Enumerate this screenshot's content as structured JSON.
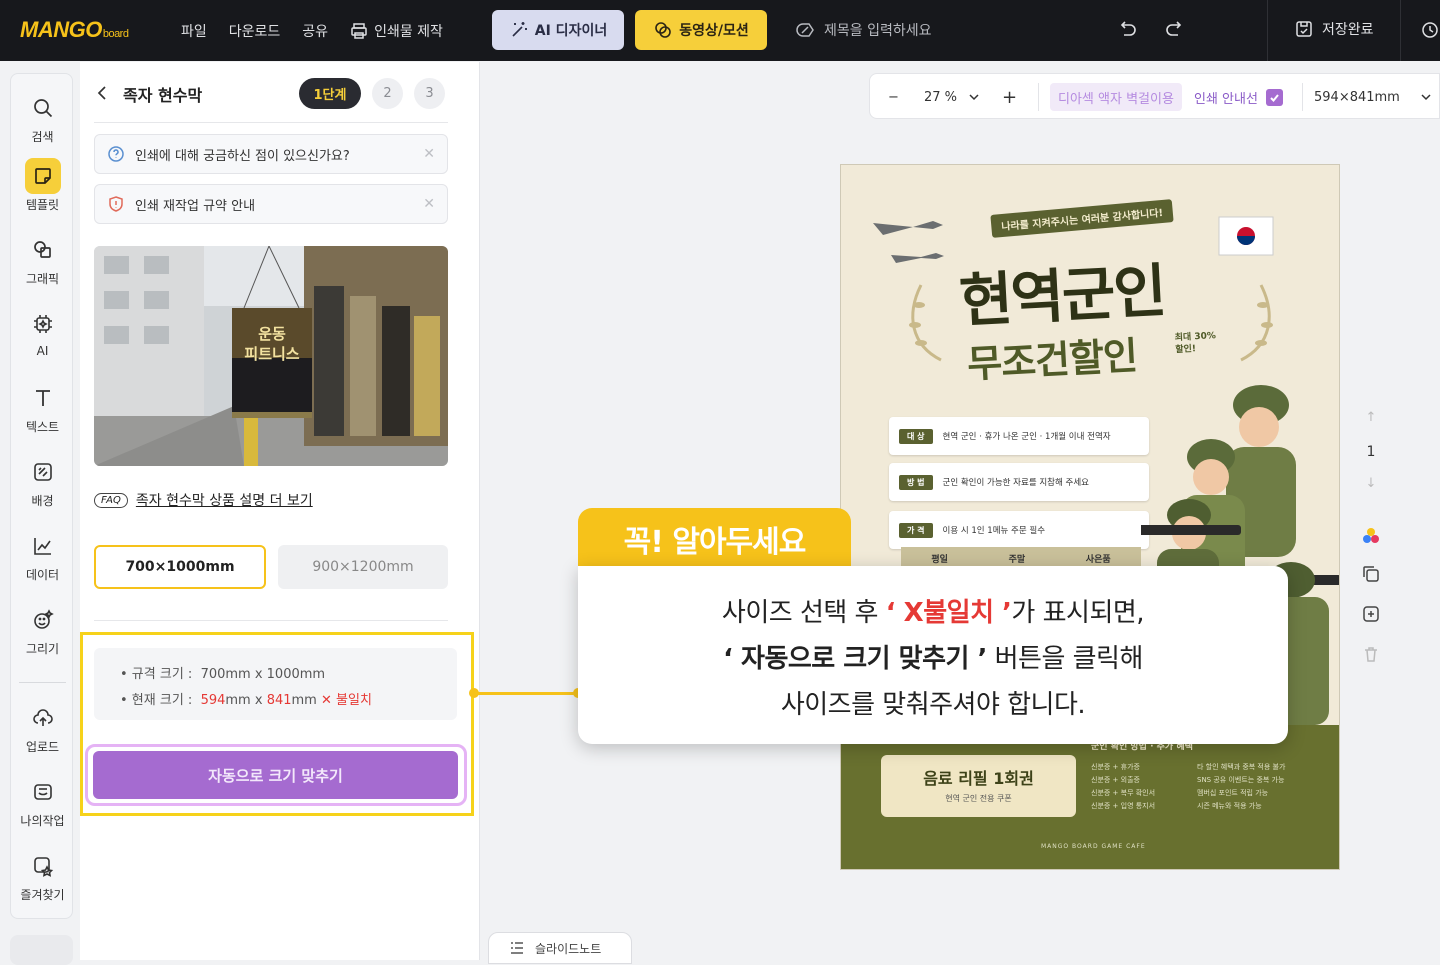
{
  "topbar": {
    "logo_main": "MANGO",
    "logo_sub": "board",
    "menu": [
      "파일",
      "다운로드",
      "공유",
      "인쇄물 제작"
    ],
    "ai_designer": "AI 디자이너",
    "video_motion": "동영상/모션",
    "title_placeholder": "제목을 입력하세요",
    "save_status": "저장완료"
  },
  "leftnav": {
    "items": [
      "검색",
      "템플릿",
      "그래픽",
      "AI",
      "텍스트",
      "배경",
      "데이터",
      "그리기",
      "업로드",
      "나의작업",
      "즐겨찾기"
    ],
    "active": "템플릿"
  },
  "panel": {
    "title": "족자 현수막",
    "steps": [
      "1단계",
      "2",
      "3"
    ],
    "notice1": "인쇄에 대해 궁금하신 점이 있으신가요?",
    "notice2": "인쇄 재작업 규약 안내",
    "faq_tag": "FAQ",
    "faq_link": "족자 현수막 상품 설명 더 보기",
    "size_options": [
      "700×1000mm",
      "900×1200mm"
    ],
    "selected_size": "700×1000mm",
    "spec_label": "• 규격 크기 :",
    "spec_value": "700mm x 1000mm",
    "current_label": "• 현재 크기 :",
    "current_w": "594",
    "current_mm1": "mm x",
    "current_h": "841",
    "current_mm2": "mm",
    "mismatch": "불일치",
    "autofit_button": "자동으로 크기 맞추기"
  },
  "photo": {
    "poster_line1": "운동",
    "poster_line2": "피트니스"
  },
  "canvas_toolbar": {
    "zoom": "27 %",
    "minus": "−",
    "plus": "+",
    "material_tag": "디아섹 액자 벽걸이용",
    "print_guide": "인쇄 안내선",
    "paper_size": "594×841mm"
  },
  "poster": {
    "banner": "나라를 지켜주시는 여러분 감사합니다!",
    "title": "현역군인",
    "subtitle": "무조건할인",
    "max_badge": "최대 30% 할인!",
    "rows": [
      {
        "tag": "대 상",
        "text": "현역 군인 · 휴가 나온 군인 · 1개월 이내 전역자"
      },
      {
        "tag": "방 법",
        "text": "군인 확인이 가능한 자료를 지참해 주세요"
      },
      {
        "tag": "가 격",
        "text": "이용 시 1인 1메뉴 주문 필수"
      }
    ],
    "table_headers": [
      "평일",
      "주말",
      "사은품"
    ],
    "coupon_title": "음료 리필 1회권",
    "coupon_sub": "현역 군인 전용 쿠폰",
    "benefit_head": "군인 확인 방법 · 추가 혜택",
    "list_left": [
      "신분증 + 휴가증",
      "신분증 + 외출증",
      "신분증 + 복무 확인서",
      "신분증 + 입영 통지서"
    ],
    "list_right": [
      "타 할인 혜택과 중복 적용 불가",
      "SNS 공유 이벤트는 중복 가능",
      "멤버십 포인트 적립 가능",
      "시즌 메뉴와 적용 가능"
    ],
    "brand": "MANGO BOARD GAME CAFE"
  },
  "page_counter": "1",
  "callout": {
    "tab": "꼭! 알아두세요",
    "l1_a": "사이즈 선택 후 ",
    "l1_red": "‘ X불일치 ’",
    "l1_b": "가 표시되면,",
    "l2_bold": "‘ 자동으로 크기 맞추기 ’",
    "l2_b": " 버튼을 클릭해",
    "l3": "사이즈를 맞춰주셔야 합니다."
  },
  "slide_notes": "슬라이드노트",
  "colors": {
    "accent_yellow": "#f6c21a",
    "purple": "#a56bd0",
    "error_red": "#e53935",
    "topbar_bg": "#17181c"
  }
}
